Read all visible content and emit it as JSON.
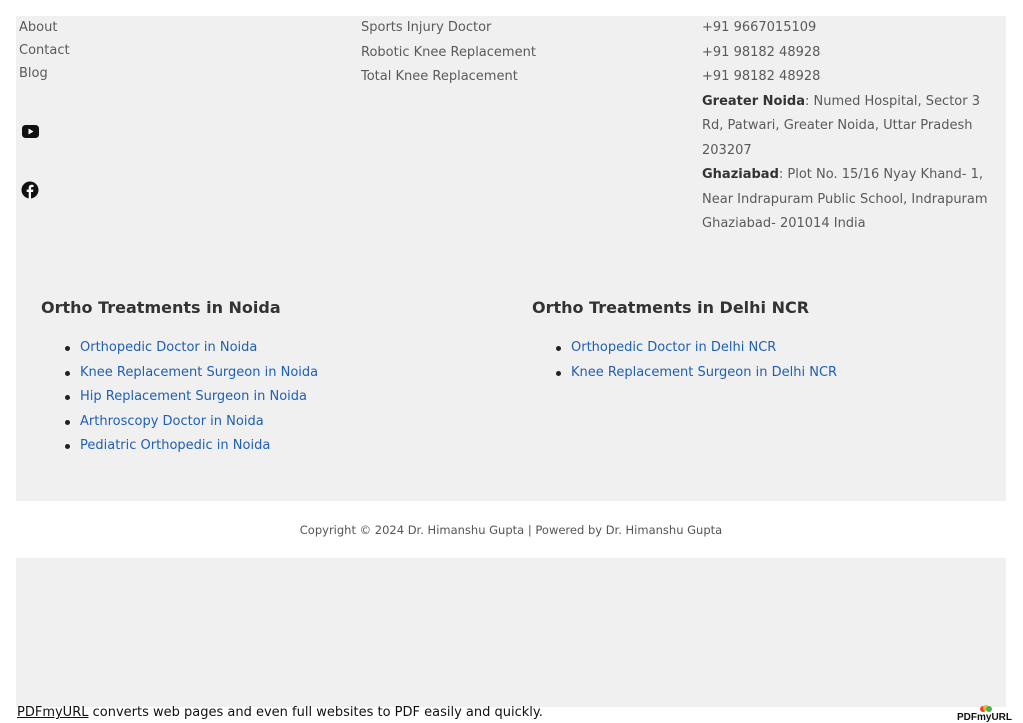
{
  "footer": {
    "quick_links": [
      "About",
      "Contact",
      "Blog"
    ],
    "services": [
      "Sports Injury Doctor",
      "Robotic Knee Replacement",
      "Total Knee Replacement"
    ],
    "contact": {
      "phones": [
        "+91 9667015109",
        "+91 98182 48928",
        "+91 98182 48928"
      ],
      "addresses": [
        {
          "label": "Greater Noida",
          "text": ": Numed Hospital, Sector 3 Rd, Patwari, Greater Noida, Uttar Pradesh 203207"
        },
        {
          "label": "Ghaziabad",
          "text": ": Plot No. 15/16 Nyay Khand- 1, Near Indrapuram Public School, Indrapuram Ghaziabad- 201014 India"
        }
      ]
    },
    "social": [
      {
        "icon": "youtube-icon"
      },
      {
        "icon": "facebook-icon"
      }
    ]
  },
  "treatments_noida": {
    "title": "Ortho Treatments in Noida",
    "items": [
      "Orthopedic Doctor in Noida",
      "Knee Replacement Surgeon in Noida",
      "Hip Replacement Surgeon in Noida",
      "Arthroscopy Doctor in Noida",
      "Pediatric Orthopedic in Noida"
    ]
  },
  "treatments_delhi": {
    "title": "Ortho Treatments in Delhi NCR",
    "items": [
      "Orthopedic Doctor in Delhi NCR",
      "Knee Replacement Surgeon in Delhi NCR"
    ]
  },
  "copyright": "Copyright © 2024 Dr. Himanshu Gupta | Powered by Dr. Himanshu Gupta",
  "promo": {
    "link_text": "PDFmyURL",
    "text": " converts web pages and even full websites to PDF easily and quickly.",
    "logo_text": "PDFmyURL"
  },
  "colors": {
    "link_blue": "#1f5fb5",
    "page_bg": "#f0f0f0"
  }
}
